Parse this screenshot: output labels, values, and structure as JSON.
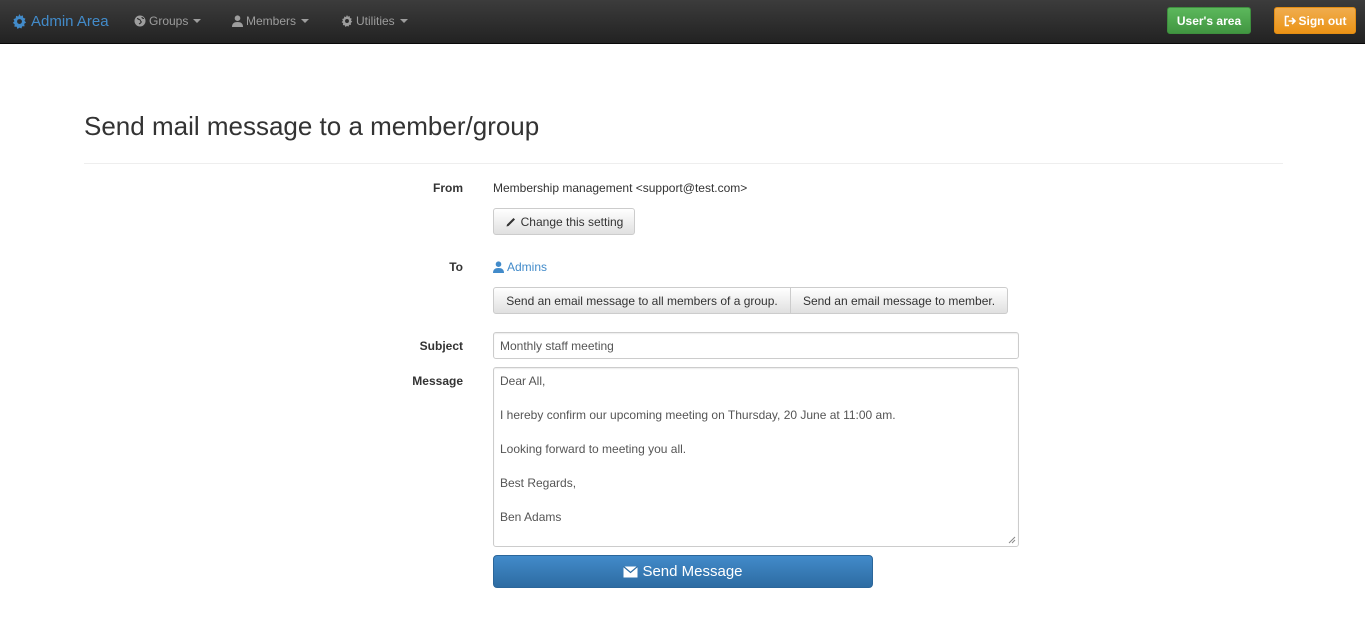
{
  "navbar": {
    "brand": "Admin Area",
    "menus": [
      {
        "label": "Groups",
        "icon": "globe-icon"
      },
      {
        "label": "Members",
        "icon": "user-icon"
      },
      {
        "label": "Utilities",
        "icon": "gear-icon"
      }
    ],
    "users_area_label": "User's area",
    "sign_out_label": "Sign out"
  },
  "page": {
    "title": "Send mail message to a member/group"
  },
  "form": {
    "from_label": "From",
    "from_value": "Membership management <support@test.com>",
    "change_setting_label": "Change this setting",
    "to_label": "To",
    "to_value": "Admins",
    "group_button_label": "Send an email message to all members of a group.",
    "member_button_label": "Send an email message to member.",
    "subject_label": "Subject",
    "subject_value": "Monthly staff meeting",
    "message_label": "Message",
    "message_lines": [
      "Dear All,",
      "",
      "I hereby confirm our upcoming meeting on Thursday, 20 June at 11:00 am.",
      "",
      "Looking forward to meeting you all.",
      "",
      "Best Regards,",
      "",
      "Ben Adams"
    ],
    "send_label": "Send Message"
  },
  "colors": {
    "brand": "#428bca",
    "success": "#5cb85c",
    "warning": "#f0ad4e",
    "primary": "#2d6ca2"
  }
}
